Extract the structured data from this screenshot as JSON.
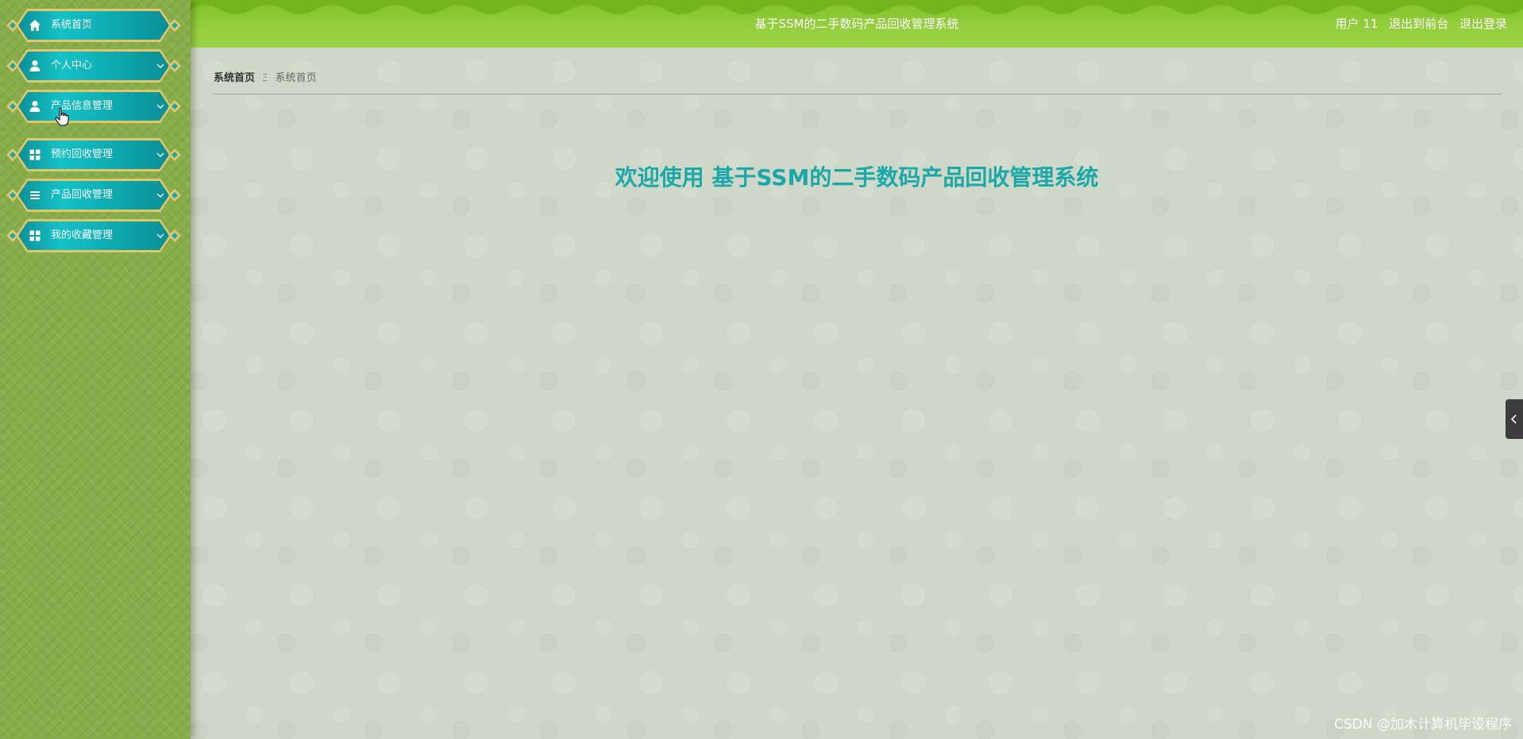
{
  "header": {
    "title": "基于SSM的二手数码产品回收管理系统",
    "user": "用户 11",
    "back_to_front": "退出到前台",
    "logout": "退出登录"
  },
  "sidebar": {
    "items": [
      {
        "label": "系统首页",
        "icon": "home-icon"
      },
      {
        "label": "个人中心",
        "icon": "user-icon"
      },
      {
        "label": "产品信息管理",
        "icon": "user-icon"
      },
      {
        "label": "预约回收管理",
        "icon": "grid-icon"
      },
      {
        "label": "产品回收管理",
        "icon": "list-icon"
      },
      {
        "label": "我的收藏管理",
        "icon": "grid-icon"
      }
    ]
  },
  "breadcrumb": {
    "home": "系统首页",
    "separator": "Ξ",
    "current": "系统首页"
  },
  "main": {
    "welcome": "欢迎使用 基于SSM的二手数码产品回收管理系统"
  },
  "watermark": "CSDN @加木计算机毕设程序",
  "colors": {
    "header_green": "#94ce3d",
    "sidebar_green": "#86ad4a",
    "menu_teal": "#0fb0b7",
    "menu_gold": "#e3c66a",
    "welcome_teal": "#1aa8a8"
  }
}
